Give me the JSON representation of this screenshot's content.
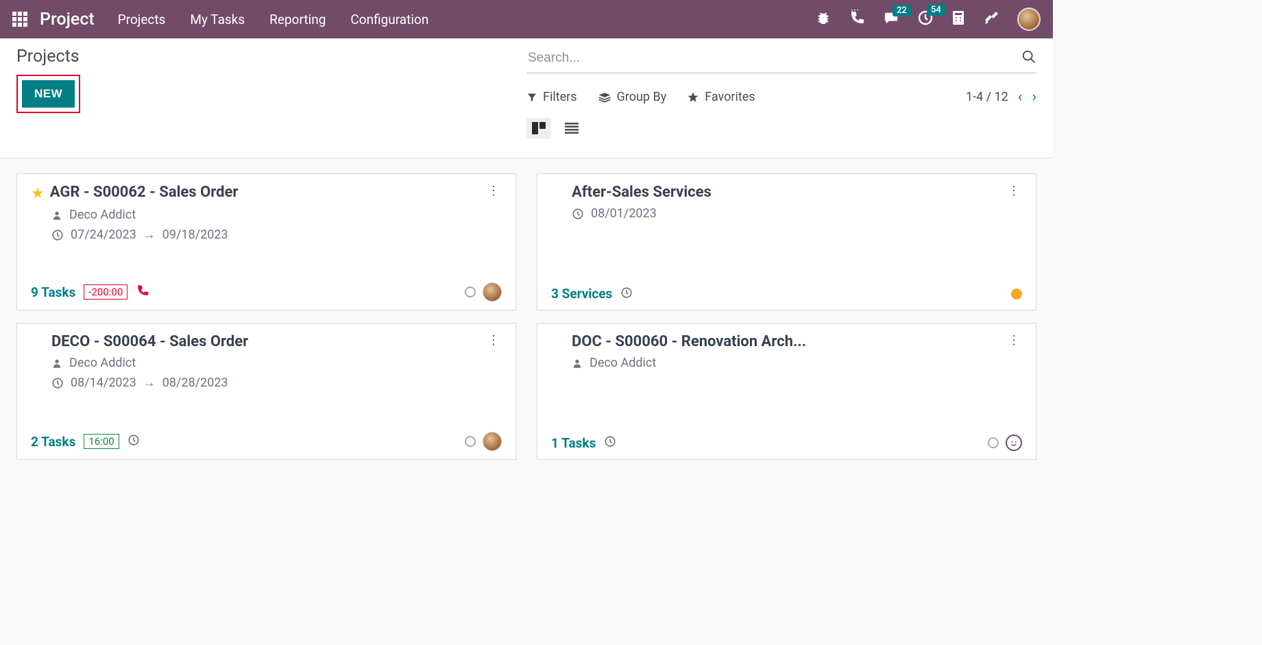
{
  "brand": "Project",
  "menu": {
    "projects": "Projects",
    "my_tasks": "My Tasks",
    "reporting": "Reporting",
    "configuration": "Configuration"
  },
  "badges": {
    "messages": "22",
    "activities": "54"
  },
  "breadcrumb": "Projects",
  "new_button": "NEW",
  "search": {
    "placeholder": "Search..."
  },
  "filters": {
    "filters_label": "Filters",
    "groupby_label": "Group By",
    "favorites_label": "Favorites"
  },
  "pager": {
    "range": "1-4 / 12"
  },
  "cards": [
    {
      "title": "AGR - S00062 - Sales Order",
      "starred": true,
      "customer": "Deco Addict",
      "date_start": "07/24/2023",
      "date_end": "09/18/2023",
      "count_label": "9 Tasks",
      "time": "-200:00",
      "time_class": "neg",
      "phone": true,
      "avatar": true,
      "clock": false,
      "circle": true,
      "circle_color": "",
      "smile": false
    },
    {
      "title": "After-Sales Services",
      "starred": false,
      "customer": "",
      "date_start": "08/01/2023",
      "date_end": "",
      "count_label": "3 Services",
      "time": "",
      "time_class": "",
      "phone": false,
      "avatar": false,
      "clock": true,
      "circle": true,
      "circle_color": "orange",
      "smile": false
    },
    {
      "title": "DECO - S00064 - Sales Order",
      "starred": false,
      "customer": "Deco Addict",
      "date_start": "08/14/2023",
      "date_end": "08/28/2023",
      "count_label": "2 Tasks",
      "time": "16:00",
      "time_class": "pos",
      "phone": false,
      "avatar": true,
      "clock": true,
      "circle": true,
      "circle_color": "",
      "smile": false
    },
    {
      "title": "DOC - S00060 - Renovation Arch...",
      "starred": false,
      "customer": "Deco Addict",
      "date_start": "",
      "date_end": "",
      "count_label": "1 Tasks",
      "time": "",
      "time_class": "",
      "phone": false,
      "avatar": false,
      "clock": true,
      "circle": true,
      "circle_color": "",
      "smile": true
    }
  ]
}
